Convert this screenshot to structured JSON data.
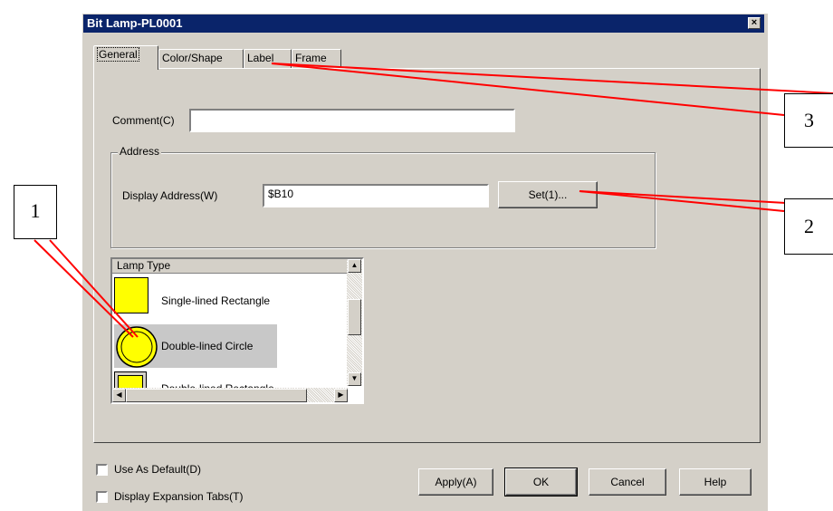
{
  "window": {
    "title": "Bit Lamp-PL0001",
    "close_symbol": "×"
  },
  "tabs": [
    {
      "label": "General",
      "active": true
    },
    {
      "label": "Color/Shape",
      "active": false
    },
    {
      "label": "Label",
      "active": false
    },
    {
      "label": "Frame",
      "active": false
    }
  ],
  "comment": {
    "label": "Comment(C)",
    "value": ""
  },
  "address": {
    "group_title": "Address",
    "display_label": "Display Address(W)",
    "value": "$B10",
    "set_button": "Set(1)..."
  },
  "lamp_type": {
    "header": "Lamp Type",
    "items": [
      {
        "name": "Single-lined Rectangle",
        "shape": "rectangle",
        "selected": false
      },
      {
        "name": "Double-lined Circle",
        "shape": "circle",
        "selected": true
      },
      {
        "name": "Double-lined Rectangle",
        "shape": "double-rectangle",
        "selected": false
      }
    ],
    "fill_color": "#ffff00"
  },
  "options": {
    "use_as_default": "Use As Default(D)",
    "display_expansion_tabs": "Display Expansion Tabs(T)"
  },
  "buttons": {
    "apply": "Apply(A)",
    "ok": "OK",
    "cancel": "Cancel",
    "help": "Help"
  },
  "callouts": [
    {
      "label": "1"
    },
    {
      "label": "2"
    },
    {
      "label": "3"
    }
  ],
  "callout_line_color": "#ff0000"
}
